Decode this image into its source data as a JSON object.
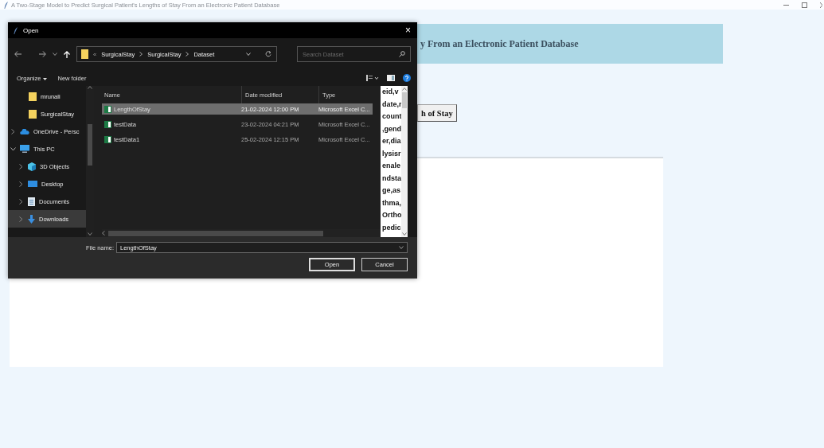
{
  "window": {
    "title": "A Two-Stage Model to Predict Surgical Patient's Lengths of Stay From an Electronic Patient Database"
  },
  "header": {
    "title": "y From an Electronic Patient Database"
  },
  "action_button": {
    "label": "h of Stay"
  },
  "dialog": {
    "title": "Open",
    "close": "×",
    "breadcrumbs": [
      "SurgicalStay",
      "SurgicalStay",
      "Dataset"
    ],
    "overflow_marker": "«",
    "search": {
      "placeholder": "Search Dataset"
    },
    "toolbar": {
      "organize": "Organize",
      "new_folder": "New folder"
    },
    "nav_items": [
      {
        "label": "mrunali",
        "kind": "folder",
        "selected": false
      },
      {
        "label": "SurgicalStay",
        "kind": "folder",
        "selected": false
      },
      {
        "label": "OneDrive - Persc",
        "kind": "cloud",
        "expanded": false,
        "selected": false
      },
      {
        "label": "This PC",
        "kind": "pc",
        "expanded": true,
        "selected": false,
        "children": [
          {
            "label": "3D Objects",
            "kind": "objects",
            "expanded": false,
            "selected": false
          },
          {
            "label": "Desktop",
            "kind": "desktop",
            "expanded": false,
            "selected": false
          },
          {
            "label": "Documents",
            "kind": "documents",
            "expanded": false,
            "selected": false
          },
          {
            "label": "Downloads",
            "kind": "downloads",
            "expanded": false,
            "selected": true
          }
        ]
      }
    ],
    "columns": [
      "Name",
      "Date modified",
      "Type"
    ],
    "files": [
      {
        "name": "LengthOfStay",
        "date": "21-02-2024 12:00 PM",
        "type": "Microsoft Excel C...",
        "selected": true
      },
      {
        "name": "testData",
        "date": "23-02-2024 04:21 PM",
        "type": "Microsoft Excel C...",
        "selected": false
      },
      {
        "name": "testData1",
        "date": "25-02-2024 12:15 PM",
        "type": "Microsoft Excel C...",
        "selected": false
      }
    ],
    "preview": "eid,v\ndate,r\ncount\n,gend\ner,dia\nlysisr\nenale\nndsta\nge,as\nthma,\nOrtho\npedic",
    "file_name": {
      "label": "File name:",
      "value": "LengthOfStay"
    },
    "buttons": [
      "Open",
      "Cancel"
    ]
  }
}
